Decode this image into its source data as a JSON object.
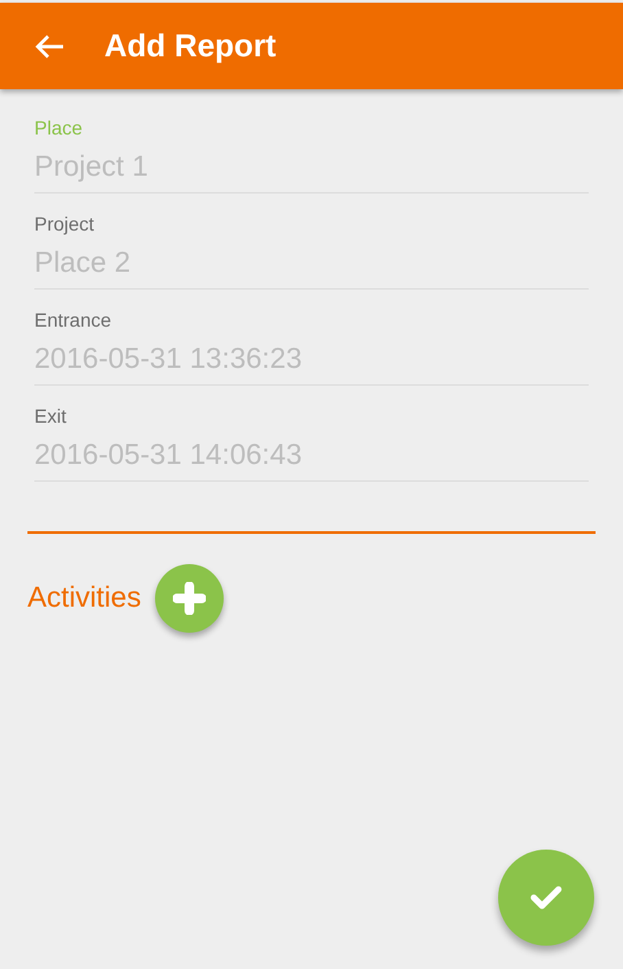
{
  "app_bar": {
    "title": "Add Report"
  },
  "fields": [
    {
      "label": "Place",
      "value": "Project 1",
      "focused": true
    },
    {
      "label": "Project",
      "value": "Place 2",
      "focused": false
    },
    {
      "label": "Entrance",
      "value": "2016-05-31 13:36:23",
      "focused": false
    },
    {
      "label": "Exit",
      "value": "2016-05-31 14:06:43",
      "focused": false
    }
  ],
  "activities": {
    "title": "Activities"
  }
}
